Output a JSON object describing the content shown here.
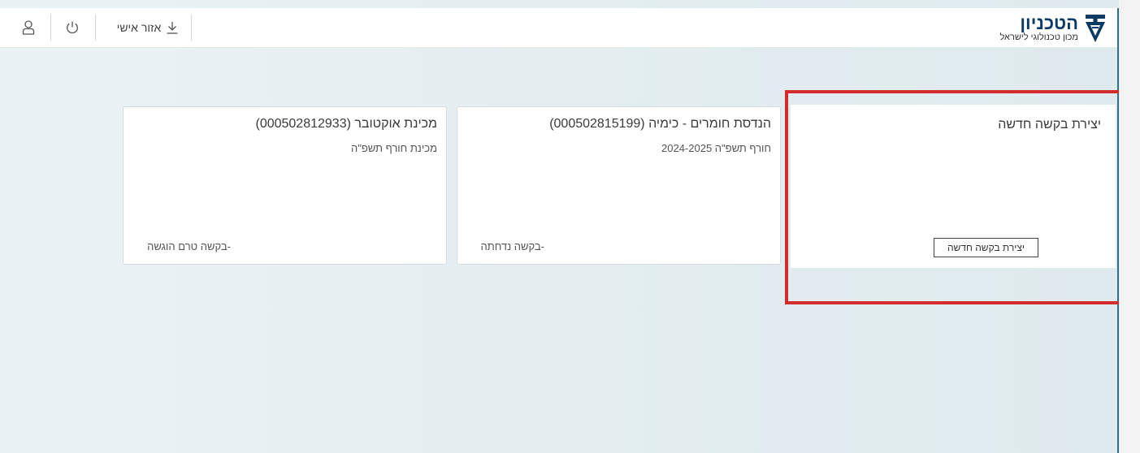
{
  "header": {
    "personal_area_label": "אזור אישי",
    "logo": {
      "title": "הטכניון",
      "subtitle": "מכון טכנולוגי לישראל"
    }
  },
  "cards": [
    {
      "title": "מכינת אוקטובר (000502812933)",
      "subtitle": "מכינת חורף תשפ\"ה",
      "status": "-בקשה טרם הוגשה"
    },
    {
      "title": "הנדסת חומרים - כימיה (000502815199)",
      "subtitle": "חורף תשפ\"ה 2024-2025",
      "status": "-בקשה נדחתה"
    }
  ],
  "new_request": {
    "title": "יצירת בקשה חדשה",
    "button_label": "יצירת בקשה חדשה"
  },
  "colors": {
    "highlight": "#d22c2c",
    "brand": "#0c3a66"
  },
  "icons": [
    "user-icon",
    "power-icon",
    "download-icon",
    "technion-logo"
  ]
}
